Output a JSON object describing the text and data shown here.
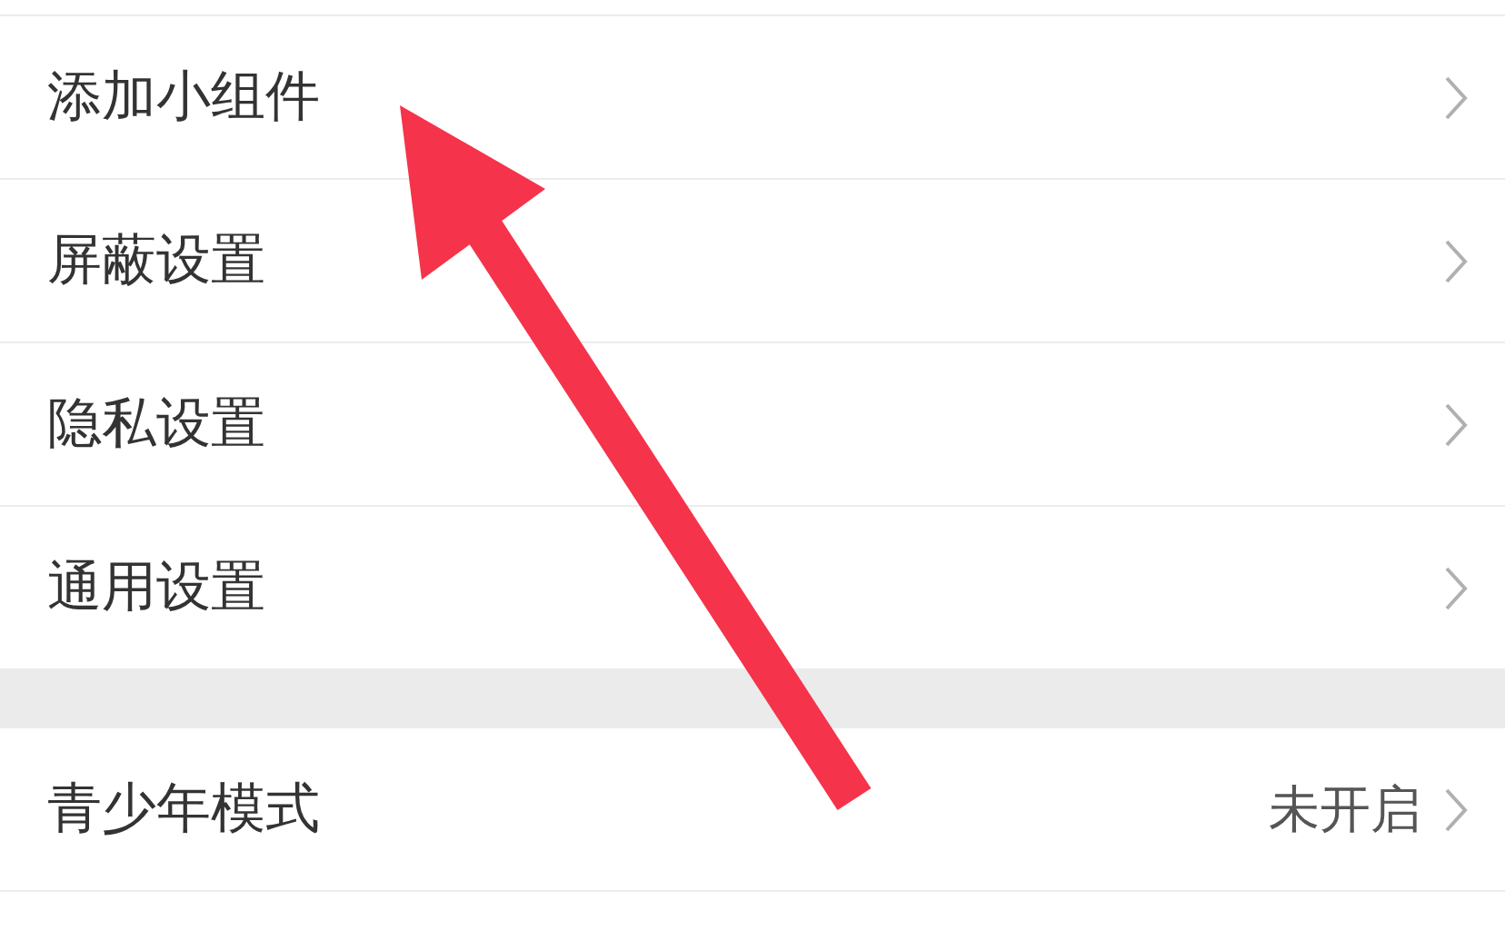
{
  "settings_groups": [
    {
      "items": [
        {
          "label": "添加小组件"
        },
        {
          "label": "屏蔽设置"
        },
        {
          "label": "隐私设置"
        },
        {
          "label": "通用设置"
        }
      ]
    },
    {
      "items": [
        {
          "label": "青少年模式",
          "value": "未开启"
        }
      ]
    }
  ]
}
